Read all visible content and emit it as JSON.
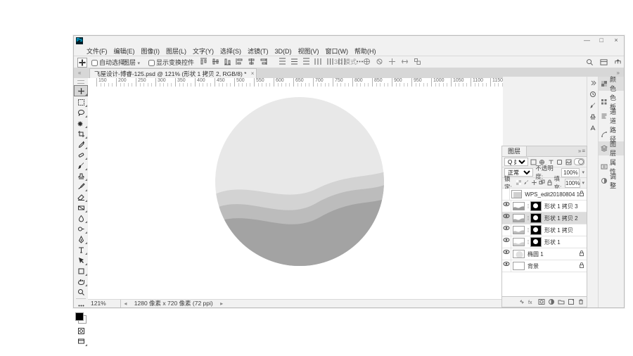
{
  "window": {
    "logo": "Ps",
    "min": "—",
    "max": "□",
    "close": "×"
  },
  "menu": {
    "items": [
      "文件(F)",
      "编辑(E)",
      "图像(I)",
      "图层(L)",
      "文字(Y)",
      "选择(S)",
      "滤镜(T)",
      "3D(D)",
      "视图(V)",
      "窗口(W)",
      "帮助(H)"
    ]
  },
  "option_bar": {
    "auto_select": "自动选择:",
    "target": "图层",
    "show_transform": "显示变换控件",
    "mode3d": "3D 模式:"
  },
  "document": {
    "tab": "飞屋设计-博睿-125.psd @ 121% (形状 1 拷贝 2, RGB/8) *",
    "tab_close": "×",
    "left_arrow": "«",
    "right_arrow": "»"
  },
  "ruler": {
    "major": [
      150,
      200,
      250,
      300,
      350,
      400,
      450,
      500,
      550,
      600,
      650,
      700,
      750,
      800,
      850,
      900,
      950,
      1000,
      1050,
      1100,
      1150
    ]
  },
  "status": {
    "zoom": "121%",
    "doc": "1280 像素 x 720 像素 (72 ppi)",
    "la": "◂",
    "ra": "▸"
  },
  "right_tabs": {
    "items": [
      {
        "icon": "swatch",
        "label": "颜色",
        "sel": true
      },
      {
        "icon": "pattern",
        "label": "色板"
      },
      {
        "icon": "para",
        "label": "通道"
      },
      {
        "icon": "path",
        "label": "路径"
      },
      {
        "icon": "layers",
        "label": "图层",
        "sel": true
      },
      {
        "icon": "props",
        "label": "属性"
      },
      {
        "icon": "adjust",
        "label": "调整"
      }
    ],
    "narrow": [
      "history",
      "brush",
      "clone",
      "char"
    ]
  },
  "layers_panel": {
    "title": "图层",
    "menu_more": "»",
    "menu_lines": "≡",
    "filter_kind": "Q 类型",
    "blend": "正常",
    "opacity_label": "不透明度:",
    "opacity": "100%",
    "lock_label": "锁定:",
    "fill_label": "填充:",
    "fill": "100%",
    "layers": [
      {
        "eye": "",
        "thumb": "meta",
        "mask": false,
        "name": "WPS_edit20180804 10...",
        "lock": "🔒"
      },
      {
        "eye": "👁",
        "thumb": "shape3",
        "mask": true,
        "name": "形状 1 拷贝 3"
      },
      {
        "eye": "👁",
        "thumb": "shape2",
        "mask": true,
        "name": "形状 1 拷贝 2",
        "sel": true
      },
      {
        "eye": "👁",
        "thumb": "shape1c",
        "mask": true,
        "name": "形状 1 拷贝"
      },
      {
        "eye": "👁",
        "thumb": "shape1",
        "mask": true,
        "name": "形状 1"
      },
      {
        "eye": "👁",
        "thumb": "ellipse",
        "mask": false,
        "name": "椭圆 1",
        "lock": "🔒"
      },
      {
        "eye": "👁",
        "thumb": "bg",
        "mask": false,
        "name": "背景",
        "lock": "🔒"
      }
    ]
  }
}
